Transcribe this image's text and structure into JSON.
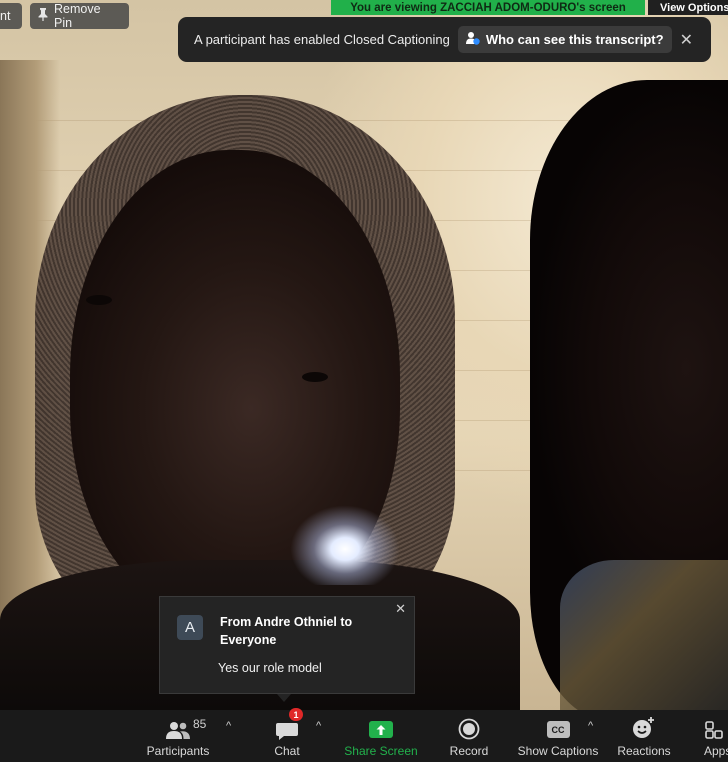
{
  "top_bar": {
    "left_pill_text": "nt",
    "remove_pin_label": "Remove Pin",
    "viewing_banner": "You are viewing ZACCIAH ADOM-ODURO's screen",
    "view_options_label": "View Options"
  },
  "caption_notice": {
    "message": "A participant has enabled Closed Captioning",
    "link_label": "Who can see this transcript?",
    "close_icon": "close-icon"
  },
  "chat_popup": {
    "avatar_letter": "A",
    "from_line": "From Andre Othniel to Everyone",
    "message": "Yes our role model",
    "close_icon": "close-icon"
  },
  "toolbar": {
    "participants": {
      "label": "Participants",
      "count": "85"
    },
    "chat": {
      "label": "Chat",
      "badge": "1"
    },
    "share_screen": {
      "label": "Share Screen"
    },
    "record": {
      "label": "Record"
    },
    "show_captions": {
      "label": "Show Captions",
      "icon_text": "CC"
    },
    "reactions": {
      "label": "Reactions"
    },
    "apps": {
      "label": "Apps"
    }
  },
  "colors": {
    "share_green": "#22b14c",
    "banner_green": "#21b04a",
    "badge_red": "#e02828",
    "toolbar_bg": "#1a1a1a"
  }
}
